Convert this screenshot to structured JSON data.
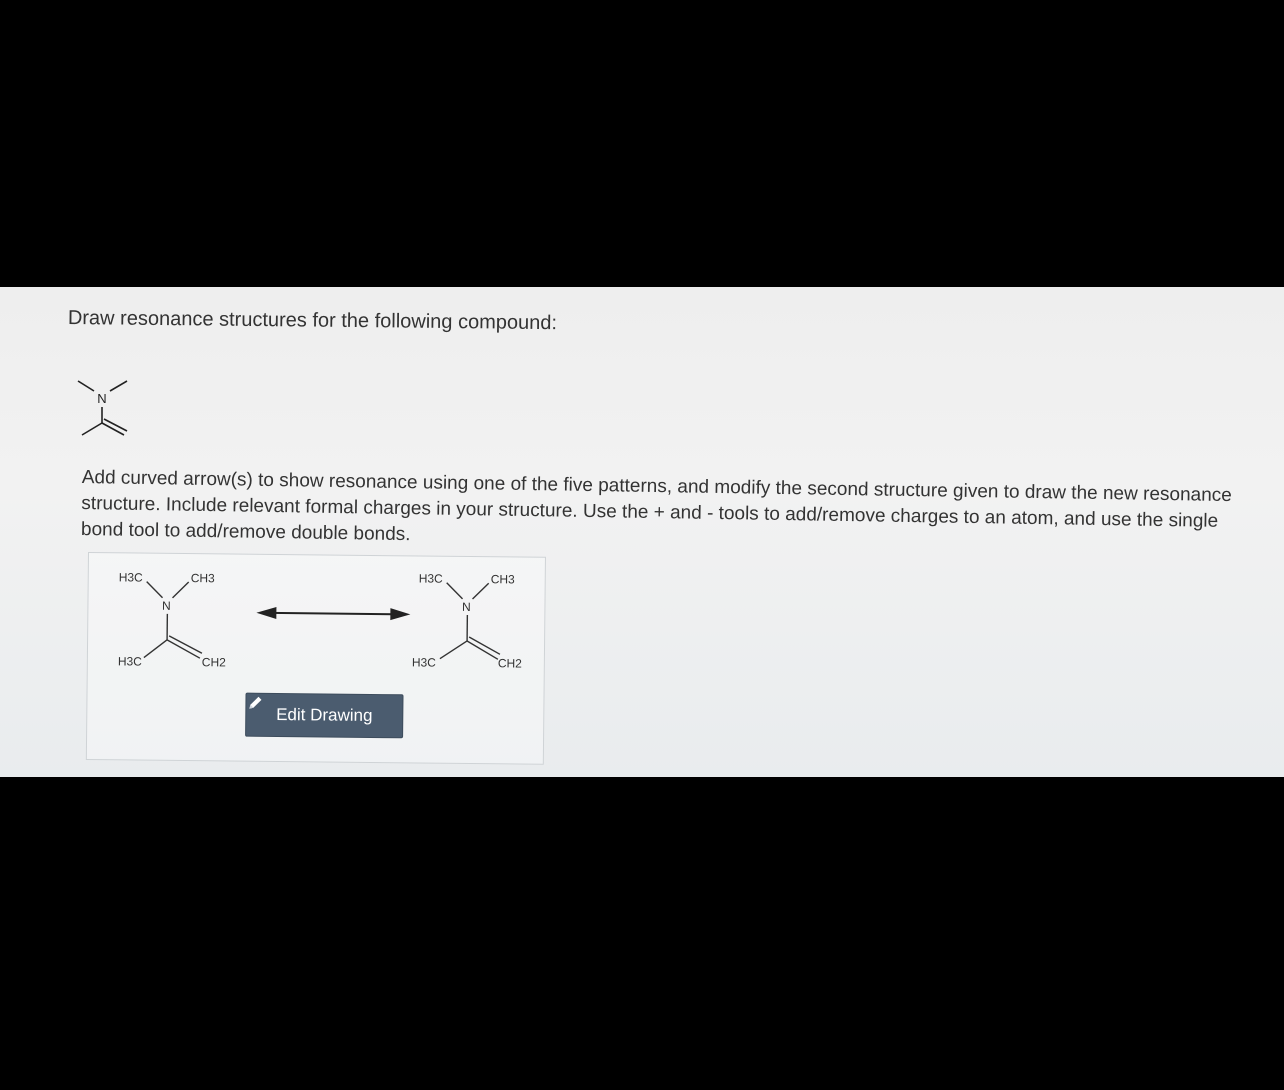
{
  "prompt": "Draw resonance structures for the following compound:",
  "instructions": "Add curved arrow(s) to show resonance using one of the five patterns, and modify the second structure given to draw the new resonance structure. Include relevant formal charges in your structure. Use the + and - tools to add/remove charges to an atom, and use the single bond tool to add/remove double bonds.",
  "thumbnail": {
    "atom_n": "N"
  },
  "structure_left": {
    "top_left": "H3C",
    "top_right": "CH3",
    "center": "N",
    "bottom_left": "H3C",
    "bottom_right": "CH2"
  },
  "structure_right": {
    "top_left": "H3C",
    "top_right": "CH3",
    "center": "N",
    "bottom_left": "H3C",
    "bottom_right": "CH2"
  },
  "edit_button": {
    "label": "Edit Drawing",
    "icon": "pencil-icon"
  }
}
